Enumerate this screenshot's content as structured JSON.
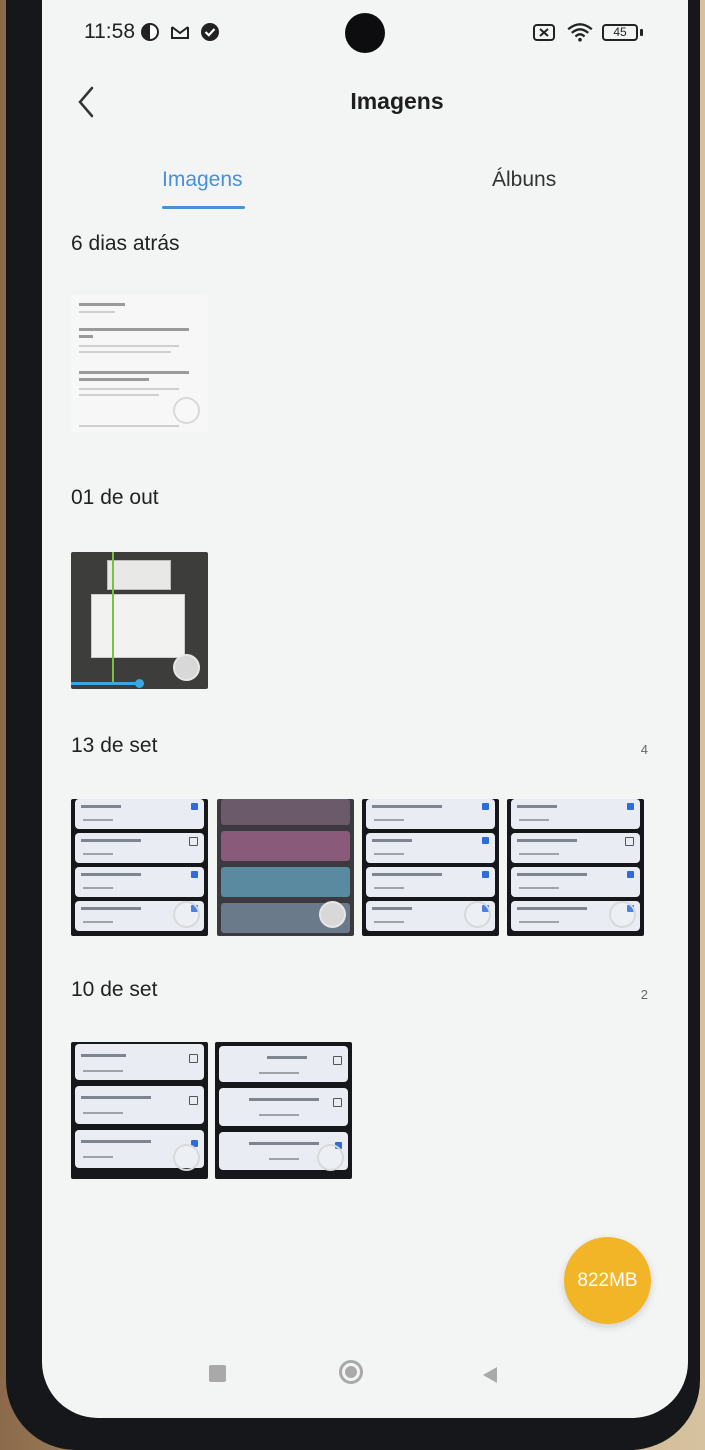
{
  "status_bar": {
    "time": "11:58",
    "battery": "45",
    "icons": [
      "notification-icon",
      "gmail-icon",
      "check-icon",
      "sim-x-icon",
      "wifi-icon",
      "battery-icon"
    ]
  },
  "header": {
    "title": "Imagens"
  },
  "tabs": [
    {
      "label": "Imagens",
      "active": true
    },
    {
      "label": "Álbuns",
      "active": false
    }
  ],
  "sections": [
    {
      "label": "6 dias atrás",
      "count": ""
    },
    {
      "label": "01 de out",
      "count": ""
    },
    {
      "label": "13 de set",
      "count": "4"
    },
    {
      "label": "10 de set",
      "count": "2"
    }
  ],
  "storage_button": {
    "label": "822MB"
  },
  "colors": {
    "accent": "#4a90d9",
    "fab": "#f3b528",
    "background": "#f3f4f4"
  }
}
